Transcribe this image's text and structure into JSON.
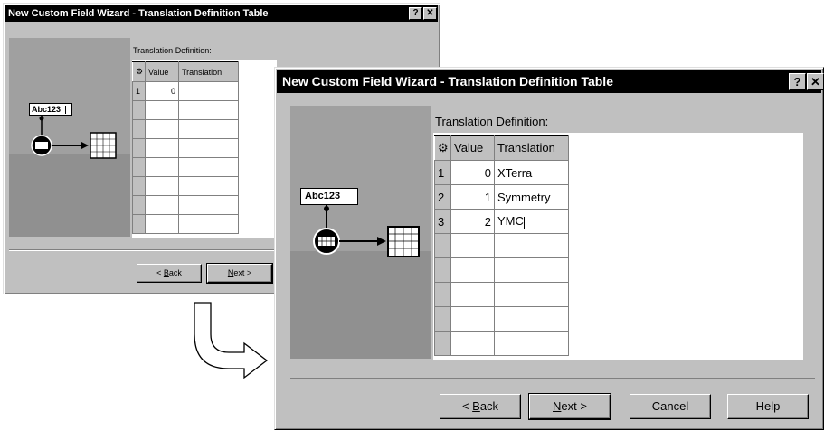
{
  "back_dialog": {
    "title": "New Custom Field Wizard - Translation Definition Table",
    "help_btn": "?",
    "close_btn": "✕",
    "graphic_text": "Abc123",
    "section_label": "Translation Definition:",
    "columns": [
      "⚙",
      "Value",
      "Translation"
    ],
    "rows": [
      {
        "n": "1",
        "value": "0",
        "translation": ""
      },
      {
        "n": "",
        "value": "",
        "translation": ""
      },
      {
        "n": "",
        "value": "",
        "translation": ""
      },
      {
        "n": "",
        "value": "",
        "translation": ""
      },
      {
        "n": "",
        "value": "",
        "translation": ""
      },
      {
        "n": "",
        "value": "",
        "translation": ""
      },
      {
        "n": "",
        "value": "",
        "translation": ""
      },
      {
        "n": "",
        "value": "",
        "translation": ""
      }
    ],
    "buttons": {
      "back_prefix": "< ",
      "back_key": "B",
      "back_rest": "ack",
      "next_key": "N",
      "next_rest": "ext >"
    }
  },
  "front_dialog": {
    "title": "New Custom Field Wizard - Translation Definition Table",
    "help_btn": "?",
    "close_btn": "✕",
    "graphic_text": "Abc123",
    "section_label": "Translation Definition:",
    "columns": [
      "⚙",
      "Value",
      "Translation"
    ],
    "rows": [
      {
        "n": "1",
        "value": "0",
        "translation": "XTerra"
      },
      {
        "n": "2",
        "value": "1",
        "translation": "Symmetry"
      },
      {
        "n": "3",
        "value": "2",
        "translation": "YMC"
      },
      {
        "n": "",
        "value": "",
        "translation": ""
      },
      {
        "n": "",
        "value": "",
        "translation": ""
      },
      {
        "n": "",
        "value": "",
        "translation": ""
      },
      {
        "n": "",
        "value": "",
        "translation": ""
      },
      {
        "n": "",
        "value": "",
        "translation": ""
      }
    ],
    "buttons": {
      "back_prefix": "< ",
      "back_key": "B",
      "back_rest": "ack",
      "next_key": "N",
      "next_rest": "ext >",
      "cancel": "Cancel",
      "help": "Help"
    }
  },
  "colors": {
    "titlebar": "#000000",
    "dialog": "#c0c0c0",
    "graphic": "#909090"
  }
}
